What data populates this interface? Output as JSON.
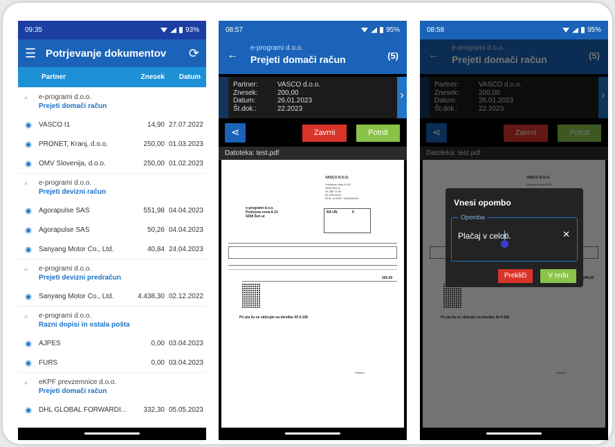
{
  "screen1": {
    "status": {
      "time": "09:35",
      "battery": "93%"
    },
    "title": "Potrjevanje dokumentov",
    "columns": {
      "partner": "Partner",
      "amount": "Znesek",
      "date": "Datum"
    },
    "groups": [
      {
        "company": "e-programi d.o.o.",
        "type": "Prejeti domači račun",
        "rows": [
          {
            "name": "VASCO t1",
            "amount": "14,90",
            "date": "27.07.2022"
          },
          {
            "name": "PRONET, Kranj, d.o.o.",
            "amount": "250,00",
            "date": "01.03.2023"
          },
          {
            "name": "OMV Slovenija, d.o.o.",
            "amount": "250,00",
            "date": "01.02.2023"
          }
        ]
      },
      {
        "company": "e-programi d.o.o.",
        "type": "Prejeti devizni račun",
        "rows": [
          {
            "name": "Agorapulse SAS",
            "amount": "551,98",
            "date": "04.04.2023"
          },
          {
            "name": "Agorapulse SAS",
            "amount": "50,26",
            "date": "04.04.2023"
          },
          {
            "name": "Sanyang Motor Co., Ltd.",
            "amount": "40,84",
            "date": "24.04.2023"
          }
        ]
      },
      {
        "company": "e-programi d.o.o.",
        "type": "Prejeti devizni predračun",
        "rows": [
          {
            "name": "Sanyang Motor Co., Ltd.",
            "amount": "4.438,30",
            "date": "02.12.2022"
          }
        ]
      },
      {
        "company": "e-programi d.o.o.",
        "type": "Razni dopisi in ostala pošta",
        "rows": [
          {
            "name": "AJPES",
            "amount": "0,00",
            "date": "03.04.2023"
          },
          {
            "name": "FURS",
            "amount": "0,00",
            "date": "03.04.2023"
          }
        ]
      },
      {
        "company": "eKPF prevzemnice d.o.o.",
        "type": "Prejeti domači račun",
        "rows": [
          {
            "name": "DHL GLOBAL FORWARDI...",
            "amount": "332,30",
            "date": "05.05.2023"
          }
        ]
      }
    ]
  },
  "screen2": {
    "status": {
      "time": "08:57",
      "battery": "95%"
    },
    "company": "e-programi d.o.o.",
    "title": "Prejeti domači račun",
    "count": "(5)",
    "labels": {
      "partner": "Partner:",
      "amount": "Znesek:",
      "date": "Datum:",
      "docno": "Št.dok.:"
    },
    "values": {
      "partner": "VASCO d.o.o.",
      "amount": "200,00",
      "date": "26.01.2023",
      "docno": "22.2023"
    },
    "reject": "Zavrni",
    "confirm": "Potrdi",
    "file": "Datoteka: test.pdf",
    "pdf": {
      "vendor": "VASCO D.O.O.",
      "vendor_addr1": "Poslovna cona A 021",
      "vendor_addr2": "4208 Šen ur",
      "vendor_tel": "04 280 74 00",
      "vendor_fax": "04 234 68 81",
      "vendor_vat": "ID št. za DDV: SI44444444",
      "buyer": "e-programi d.o.o.",
      "buyer_addr": "Poslovna cona A 21",
      "buyer_city": "4208 Šen ur",
      "ra": "RA UN",
      "ra_no": "9",
      "total": "200,00",
      "note": "Pri pla ilu se sklicujte na številko 00 9-236",
      "sign": "Direktor"
    }
  },
  "screen3": {
    "status": {
      "time": "08:58",
      "battery": "95%"
    },
    "dialog_title": "Vnesi opombo",
    "field_label": "Opomba",
    "field_value": "Plačaj v celoti.",
    "cancel": "Prekliči",
    "ok": "V redu"
  }
}
